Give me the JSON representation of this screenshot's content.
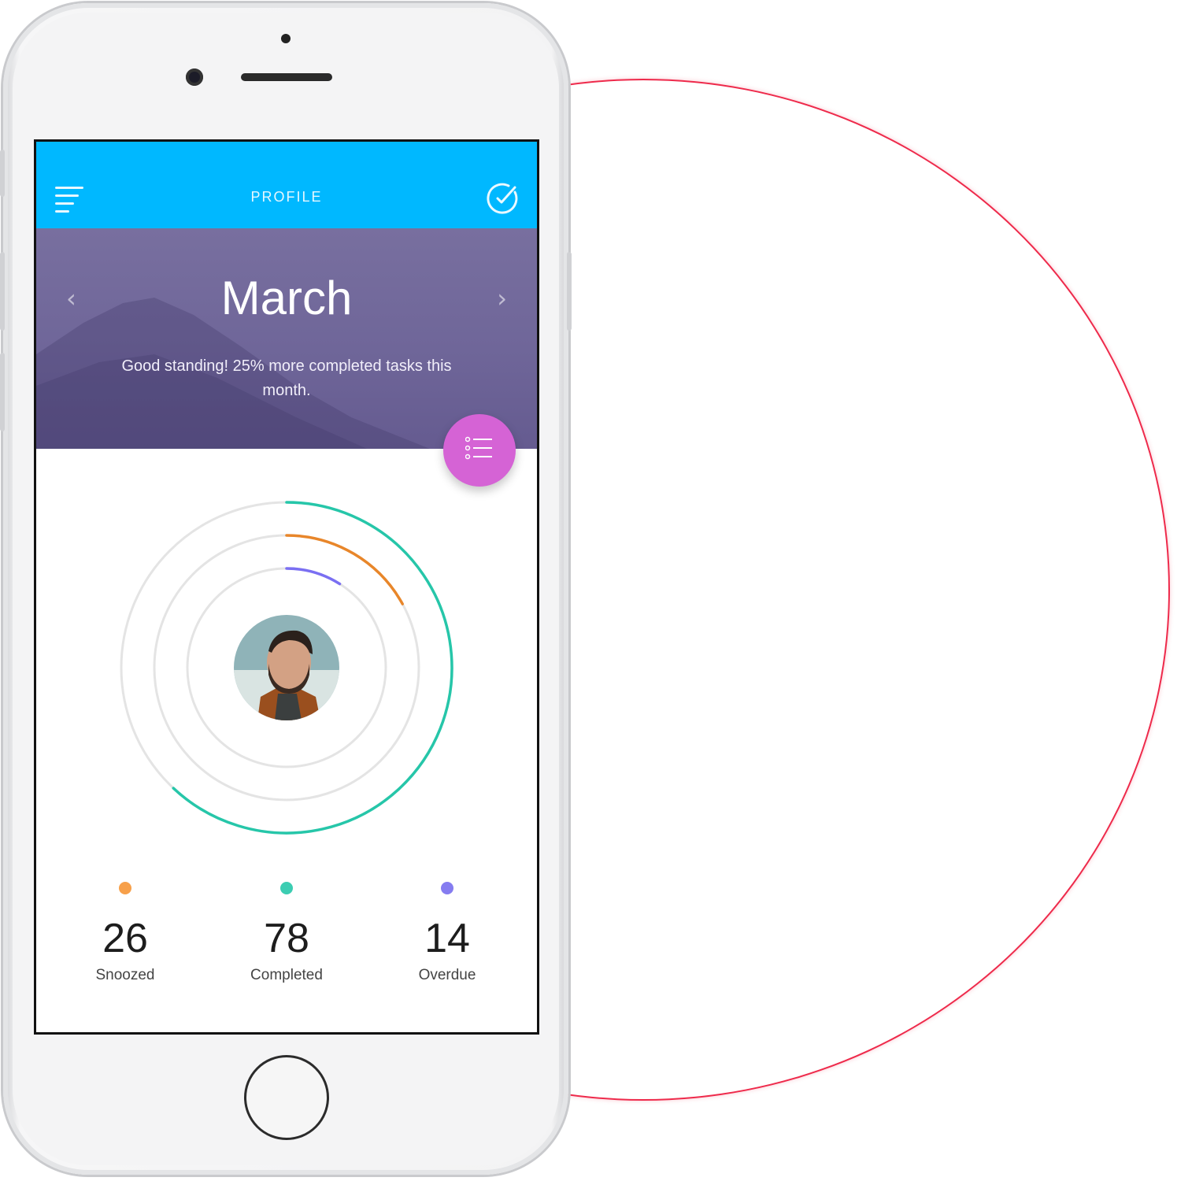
{
  "colors": {
    "topbar": "#00b8ff",
    "hero": "#726a9c",
    "fab": "#d563d5",
    "ring_outer": "#26c6a9",
    "ring_middle": "#e8862a",
    "ring_inner": "#7a6ff2",
    "ring_track": "#e4e4e4",
    "decor_circle": "#ee2a4b"
  },
  "header": {
    "title": "PROFILE",
    "menu_icon": "menu-lines-icon",
    "action_icon": "check-circle-icon"
  },
  "hero": {
    "month": "March",
    "prev_arrow": "‹",
    "next_arrow": "›",
    "message": "Good standing! 25% more completed tasks this month."
  },
  "fab": {
    "icon": "list-icon"
  },
  "progress_rings": [
    {
      "name": "Completed",
      "fraction": 0.62,
      "color": "#26c6a9"
    },
    {
      "name": "Snoozed",
      "fraction": 0.17,
      "color": "#e8862a"
    },
    {
      "name": "Overdue",
      "fraction": 0.09,
      "color": "#7a6ff2"
    }
  ],
  "stats": [
    {
      "value": "26",
      "label": "Snoozed",
      "color": "#f7a04a"
    },
    {
      "value": "78",
      "label": "Completed",
      "color": "#3ccdb2"
    },
    {
      "value": "14",
      "label": "Overdue",
      "color": "#857cf0"
    }
  ]
}
